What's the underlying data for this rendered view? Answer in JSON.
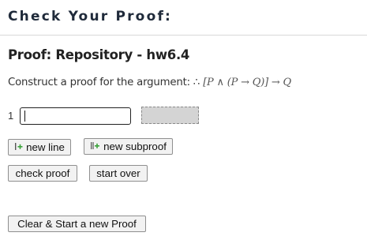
{
  "header": {
    "title": "Check Your Proof:"
  },
  "proof": {
    "title": "Proof: Repository - hw6.4",
    "instruction_prefix": "Construct a proof for the argument: ∴ ",
    "argument_formula": "[P ∧ (P → Q)] → Q",
    "lines": [
      {
        "number": "1",
        "formula_value": "",
        "justification_value": ""
      }
    ]
  },
  "buttons": {
    "new_line": "new line",
    "new_subproof": "new subproof",
    "check_proof": "check proof",
    "start_over": "start over",
    "clear_and_start_new": "Clear & Start a new Proof"
  },
  "icons": {
    "new_line": "add-line-icon",
    "new_subproof": "add-subproof-icon"
  },
  "colors": {
    "icon_green": "#3aa33a",
    "justification_fill": "#d4d4d4"
  }
}
